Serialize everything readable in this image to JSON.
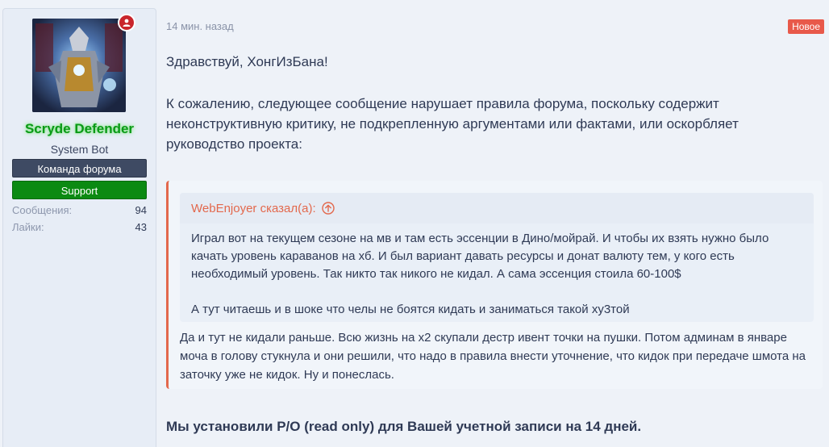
{
  "author": {
    "username": "Scryde Defender",
    "user_title": "System Bot",
    "banners": [
      "Команда форума",
      "Support"
    ],
    "stats": [
      {
        "label": "Сообщения:",
        "value": "94"
      },
      {
        "label": "Лайки:",
        "value": "43"
      }
    ]
  },
  "post": {
    "time": "14 мин. назад",
    "new_badge": "Новое",
    "greeting": "Здравствуй, ХонгИзБана!",
    "intro": "К сожалению, следующее сообщение нарушает правила форума, поскольку содержит неконструктивную критику, не подкрепленную аргументами или фактами, или оскорбляет руководство проекта:",
    "quote": {
      "attribution": "WebEnjoyer сказал(а):",
      "paragraph1": "Играл вот на текущем сезоне на мв и там есть эссенции в Дино/мойрай. И чтобы их взять нужно было качать уровень караванов на хб. И был вариант давать ресурсы и донат валюту тем, у кого есть необходимый уровень. Так никто так никого не кидал. А сама эссенция стоила 60-100$",
      "paragraph2": "А тут читаешь и в шоке что челы не боятся кидать и заниматься такой ху3той",
      "reply": "Да и тут не кидали раньше. Всю жизнь на х2 скупали дестр ивент точки на пушки. Потом админам в январе моча в голову стукнула и они решили, что надо в правила внести уточнение, что кидок при передаче шмота на заточку уже не кидок. Ну и понеслась."
    },
    "sanction": "Мы установили Р/О (read only) для Вашей учетной записи на 14 дней."
  },
  "colors": {
    "accent": "#e3684c",
    "username": "#0a9a17",
    "support": "#0b8a12",
    "team": "#3e4a63",
    "new_badge": "#e8594a"
  },
  "icons": {
    "status": "user-status-icon",
    "quote_jump": "arrow-up-circle-icon"
  }
}
